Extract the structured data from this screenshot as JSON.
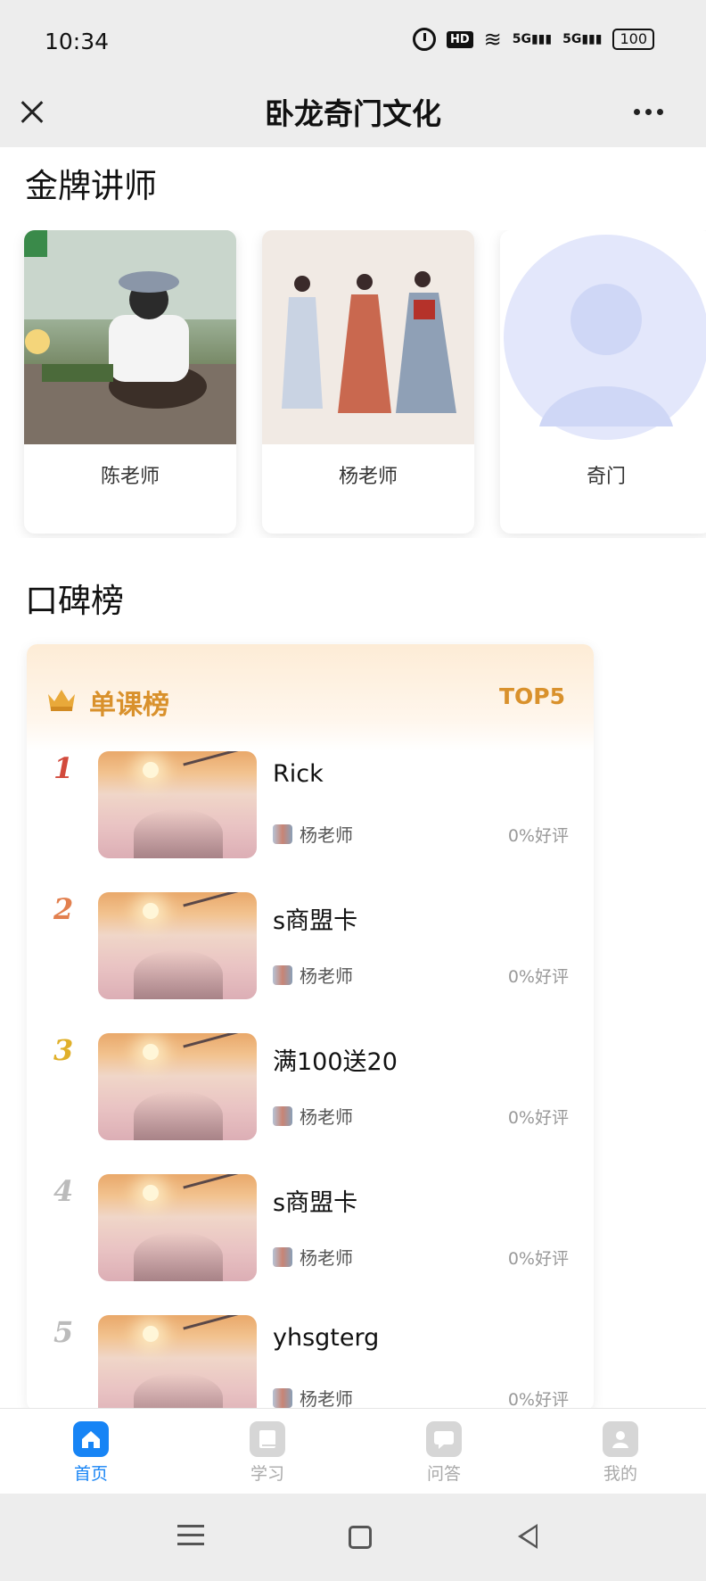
{
  "status_bar": {
    "time": "10:34",
    "hd_label": "HD",
    "signal_1": "5G",
    "signal_2": "5G",
    "battery": "100"
  },
  "header": {
    "title": "卧龙奇门文化",
    "close_icon": "close-icon",
    "more_icon": "more-icon"
  },
  "sections": {
    "teachers_title": "金牌讲师",
    "ranking_title": "口碑榜"
  },
  "teachers": [
    {
      "name": "陈老师",
      "photo": "garden-photo"
    },
    {
      "name": "杨老师",
      "photo": "hanfu-photo"
    },
    {
      "name": "奇门",
      "photo": "default-avatar"
    }
  ],
  "ranking": {
    "title": "单课榜",
    "top_label": "TOP5",
    "accent_color": "#d9912c",
    "rank_colors": [
      "#d24a3c",
      "#e2804f",
      "#e0b02a",
      "#bbbbbb",
      "#bbbbbb"
    ],
    "items": [
      {
        "rank": "1",
        "title": "Rick",
        "teacher": "杨老师",
        "rating": "0%好评"
      },
      {
        "rank": "2",
        "title": "s商盟卡",
        "teacher": "杨老师",
        "rating": "0%好评"
      },
      {
        "rank": "3",
        "title": "满100送20",
        "teacher": "杨老师",
        "rating": "0%好评"
      },
      {
        "rank": "4",
        "title": "s商盟卡",
        "teacher": "杨老师",
        "rating": "0%好评"
      },
      {
        "rank": "5",
        "title": "yhsgterg",
        "teacher": "杨老师",
        "rating": "0%好评"
      }
    ]
  },
  "bottom_nav": {
    "active_color": "#1784f5",
    "items": [
      {
        "label": "首页",
        "icon": "home-icon",
        "active": true
      },
      {
        "label": "学习",
        "icon": "book-icon",
        "active": false
      },
      {
        "label": "问答",
        "icon": "chat-icon",
        "active": false
      },
      {
        "label": "我的",
        "icon": "user-icon",
        "active": false
      }
    ]
  }
}
